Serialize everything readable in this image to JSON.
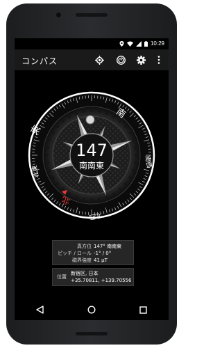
{
  "status": {
    "time": "10:29"
  },
  "appbar": {
    "title": "コンパス"
  },
  "compass": {
    "heading": "147",
    "direction": "南南東",
    "ring_labels": [
      "南",
      "南西",
      "北西",
      "北",
      "北東",
      "東"
    ],
    "red_marker_label": "北"
  },
  "sensor_info": {
    "heading_label": "真方位",
    "heading_value": "147° 南南東",
    "pitch_label": "ピッチ / ロール",
    "pitch_value": "-1° / 0°",
    "field_label": "磁界強度",
    "field_value": "41 μT"
  },
  "location_info": {
    "label": "位置",
    "place": "新宿区, 日本",
    "coords": "+35.70811, +139.70556"
  },
  "colors": {
    "accent_red": "#e53935",
    "ring_white": "#ffffff",
    "appbar": "#1a1a1a"
  }
}
